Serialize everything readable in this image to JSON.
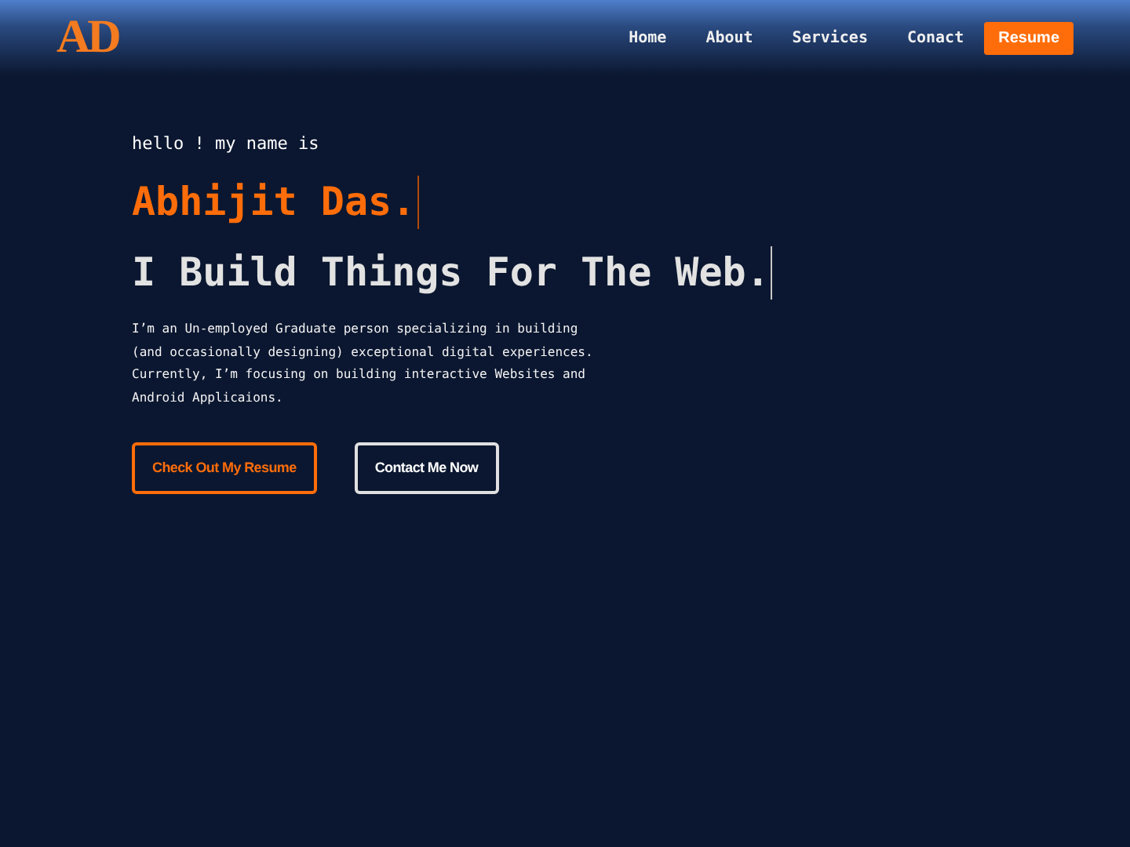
{
  "logo": "AD",
  "nav": [
    {
      "label": "Home",
      "kind": "link"
    },
    {
      "label": "About",
      "kind": "link"
    },
    {
      "label": "Services",
      "kind": "link"
    },
    {
      "label": "Conact",
      "kind": "link"
    },
    {
      "label": "Resume",
      "kind": "button"
    }
  ],
  "hero": {
    "greeting": "hello ! my name is",
    "name": "Abhijit Das.",
    "tagline": "I Build Things For The Web.",
    "description": "I’m an Un-employed Graduate person specializing in building (and occasionally designing) exceptional digital experiences. Currently, I’m focusing on building interactive Websites and Android Applicaions.",
    "buttons": [
      {
        "label": "Check Out My Resume",
        "kind": "accent"
      },
      {
        "label": "Contact Me Now",
        "kind": "plain"
      }
    ]
  }
}
